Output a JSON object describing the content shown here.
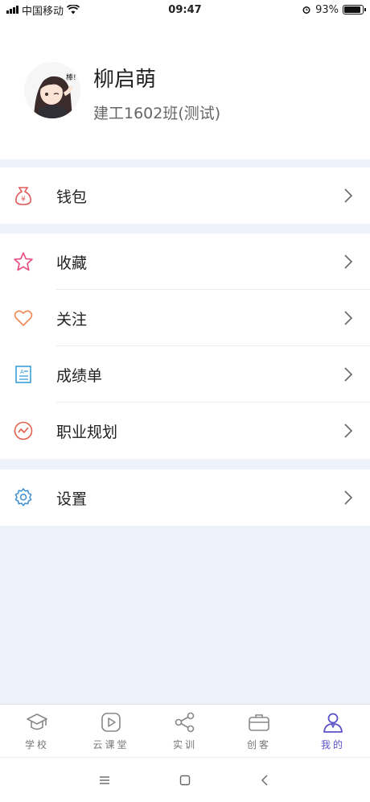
{
  "status_bar": {
    "carrier": "中国移动",
    "time": "09:47",
    "battery_percent": "93%",
    "battery_level": 0.93
  },
  "profile": {
    "name": "柳启萌",
    "class": "建工1602班(测试)"
  },
  "menu": {
    "wallet": {
      "label": "钱包",
      "icon": "wallet-icon",
      "color": "#e05a5a"
    },
    "favorites": {
      "label": "收藏",
      "icon": "star-icon",
      "color": "#e84a7f"
    },
    "follow": {
      "label": "关注",
      "icon": "heart-icon",
      "color": "#ef8a55"
    },
    "grades": {
      "label": "成绩单",
      "icon": "transcript-icon",
      "color": "#3aa0d8"
    },
    "career": {
      "label": "职业规划",
      "icon": "career-icon",
      "color": "#e2604c"
    },
    "settings": {
      "label": "设置",
      "icon": "gear-icon",
      "color": "#3a8fd3"
    }
  },
  "tabbar": {
    "tabs": [
      {
        "label": "学校",
        "icon": "school-icon"
      },
      {
        "label": "云课堂",
        "icon": "play-icon"
      },
      {
        "label": "实训",
        "icon": "share-icon"
      },
      {
        "label": "创客",
        "icon": "briefcase-icon"
      },
      {
        "label": "我的",
        "icon": "user-icon"
      }
    ],
    "active_color": "#5b52c9"
  }
}
